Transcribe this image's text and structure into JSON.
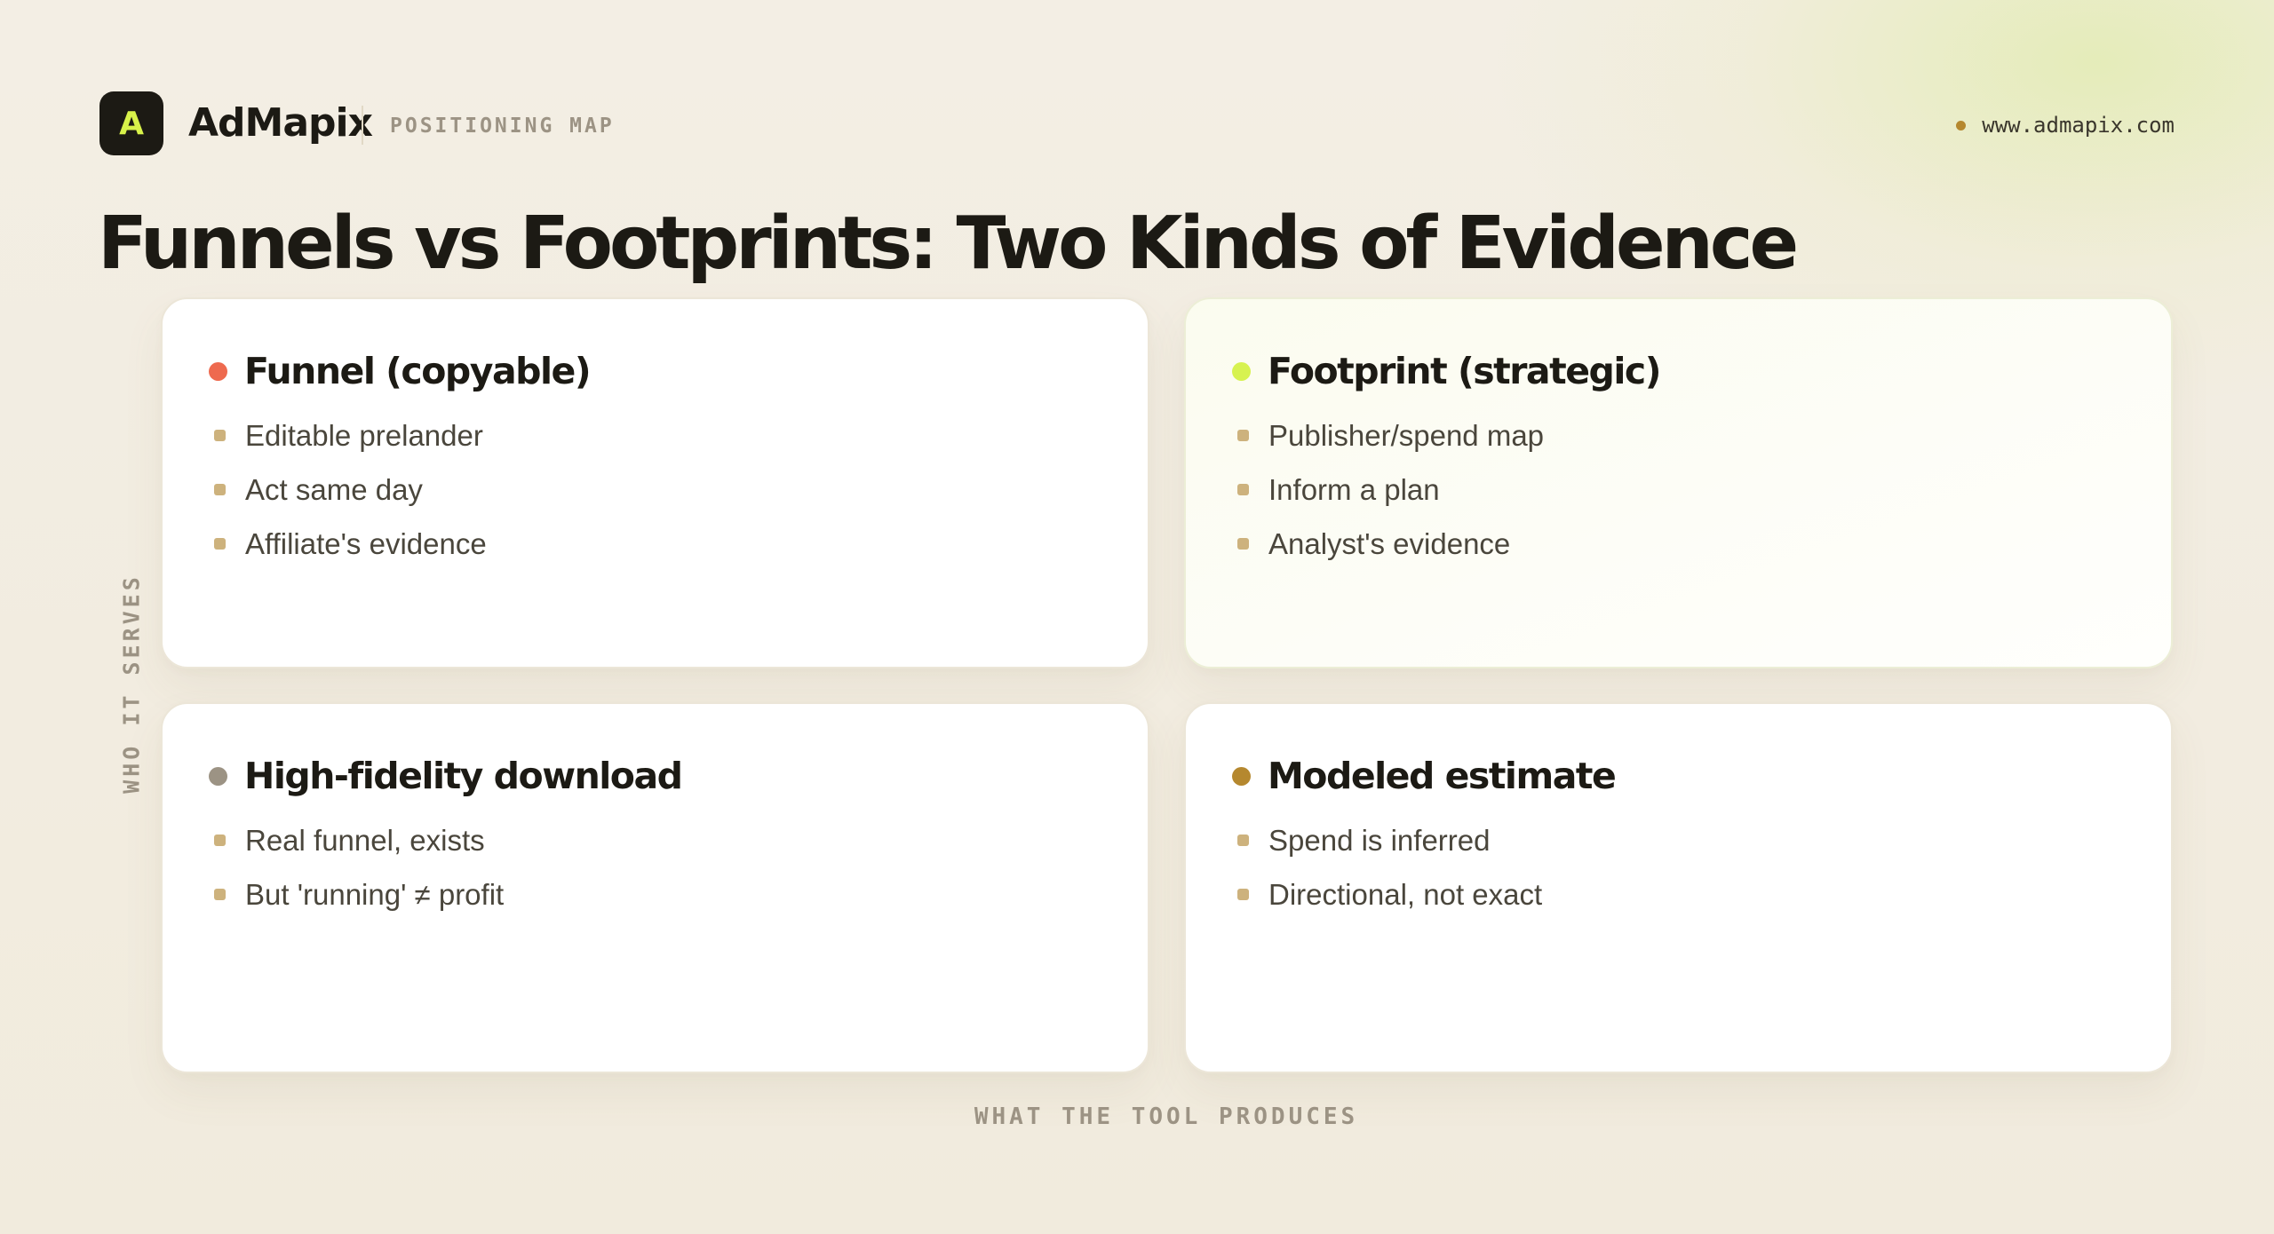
{
  "header": {
    "logo_letter": "A",
    "brand": "AdMapix",
    "section": "POSITIONING MAP",
    "site": "www.admapix.com"
  },
  "title": "Funnels vs Footprints: Two Kinds of Evidence",
  "axes": {
    "y_label": "WHO IT SERVES",
    "x_label": "WHAT THE TOOL PRODUCES"
  },
  "quadrants": [
    {
      "title": "Funnel (copyable)",
      "dot_color": "#ee6a4f",
      "items": [
        "Editable prelander",
        "Act same day",
        "Affiliate's evidence"
      ]
    },
    {
      "title": "Footprint (strategic)",
      "dot_color": "#d7f250",
      "items": [
        "Publisher/spend map",
        "Inform a plan",
        "Analyst's evidence"
      ]
    },
    {
      "title": "High-fidelity download",
      "dot_color": "#9c9384",
      "items": [
        "Real funnel, exists",
        "But 'running' ≠ profit"
      ]
    },
    {
      "title": "Modeled estimate",
      "dot_color": "#b5882f",
      "items": [
        "Spend is inferred",
        "Directional, not exact"
      ]
    }
  ],
  "colors": {
    "bullet": "#cdb27d",
    "accent_lime": "#d8f24a",
    "site_dot": "#b5882f"
  }
}
